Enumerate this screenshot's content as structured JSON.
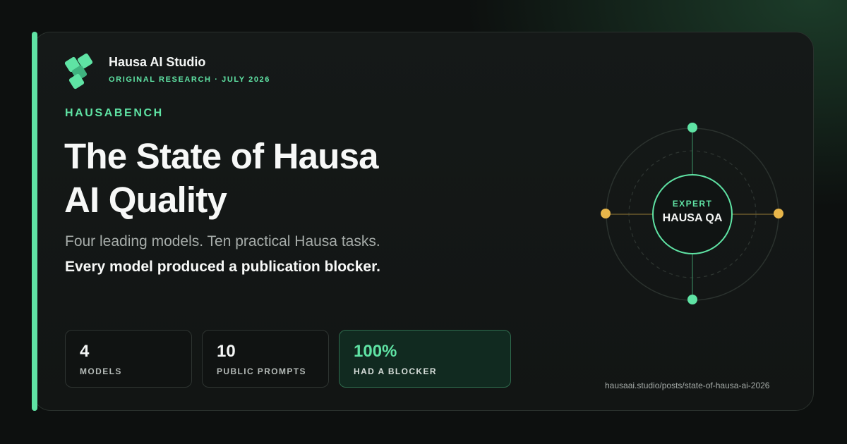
{
  "brand": {
    "name": "Hausa AI Studio",
    "subtitle": "ORIGINAL RESEARCH · JULY 2026"
  },
  "eyebrow": "HAUSABENCH",
  "headline": {
    "line1": "The State of Hausa",
    "line2": "AI Quality"
  },
  "subline": "Four leading models. Ten practical Hausa tasks.",
  "emphasis": "Every model produced a publication blocker.",
  "stats": [
    {
      "value": "4",
      "label": "MODELS"
    },
    {
      "value": "10",
      "label": "PUBLIC PROMPTS"
    },
    {
      "value": "100%",
      "label": "HAD A BLOCKER"
    }
  ],
  "diagram": {
    "center_top": "EXPERT",
    "center_bottom": "HAUSA QA"
  },
  "url": "hausaai.studio/posts/state-of-hausa-ai-2026",
  "colors": {
    "background": "#0d100f",
    "card": "#141817",
    "accent_green": "#5fe3a4",
    "accent_gold": "#e8b64a",
    "text_primary": "#f7f8f7",
    "text_muted": "#a7adaa"
  },
  "icons": [
    "hausa-ai-studio-logo-icon"
  ]
}
